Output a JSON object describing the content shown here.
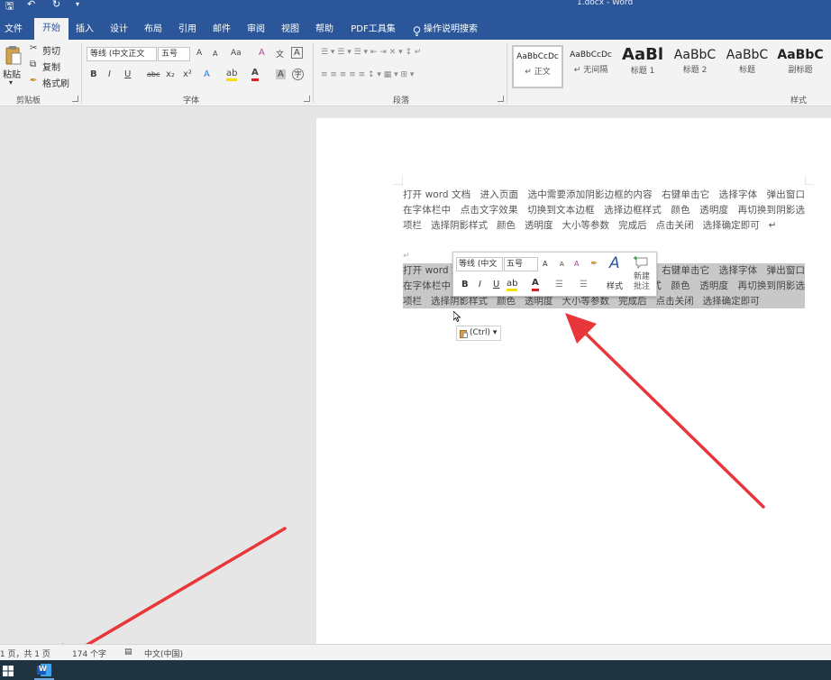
{
  "window": {
    "title": "1.docx - Word",
    "quick_access": {
      "save": "🖫",
      "undo": "↶",
      "redo": "↻",
      "customize": "▾"
    }
  },
  "tabs": [
    {
      "label": "文件"
    },
    {
      "label": "开始"
    },
    {
      "label": "插入"
    },
    {
      "label": "设计"
    },
    {
      "label": "布局"
    },
    {
      "label": "引用"
    },
    {
      "label": "邮件"
    },
    {
      "label": "审阅"
    },
    {
      "label": "视图"
    },
    {
      "label": "帮助"
    },
    {
      "label": "PDF工具集"
    }
  ],
  "tell_me": "操作说明搜索",
  "ribbon": {
    "clipboard": {
      "paste": "粘贴",
      "cut": "剪切",
      "copy": "复制",
      "format_painter": "格式刷",
      "group": "剪贴板"
    },
    "font": {
      "font_name": "等线 (中文正文",
      "font_size": "五号",
      "grow": "A",
      "shrink": "A",
      "change_case": "Aa",
      "clear_format": "A",
      "phonetic": "文",
      "char_border": "A",
      "bold": "B",
      "italic": "I",
      "underline": "U",
      "strike": "abc",
      "subscript": "x₂",
      "superscript": "x²",
      "text_effect": "A",
      "highlight": "ab",
      "font_color": "A",
      "char_shading": "A",
      "enclose": "字",
      "group": "字体"
    },
    "paragraph": {
      "group": "段落",
      "row1": "☰ ▾  ☰ ▾  ☰ ▾   ⇤  ⇥   ✕ ▾   ↕  ↵",
      "row2": "≡  ≡  ≡  ≡  ≡   ↕ ▾   ▦ ▾  ⊞ ▾"
    },
    "styles": {
      "group": "样式",
      "items": [
        {
          "preview": "AaBbCcDc",
          "name": "↵ 正文"
        },
        {
          "preview": "AaBbCcDc",
          "name": "↵ 无间隔"
        },
        {
          "preview": "AaBl",
          "name": "标题 1"
        },
        {
          "preview": "AaBbC",
          "name": "标题 2"
        },
        {
          "preview": "AaBbC",
          "name": "标题"
        },
        {
          "preview": "AaBbC",
          "name": "副标题"
        }
      ]
    }
  },
  "document": {
    "paragraph1": "打开 word 文档   进入页面   选中需要添加阴影边框的内容   右键单击它   选择字体   弹出窗口   在字体栏中   点击文字效果   切换到文本边框   选择边框样式   颜色   透明度   再切换到阴影选项栏   选择阴影样式   颜色   透明度   大小等参数   完成后   点击关闭   选择确定即可   ↵",
    "empty_mark": "↵",
    "paragraph2": "打开 word 文档   进入页面   选中需要添加阴影边框的内容   右键单击它   选择字体   弹出窗口   在字体栏中   点击文字效果   切换到文本边框   选择边框样式   颜色   透明度   再切换到阴影选项栏   选择阴影样式   颜色   透明度   大小等参数   完成后   点击关闭   选择确定即可"
  },
  "mini_toolbar": {
    "font_name": "等线 (中文",
    "font_size": "五号",
    "grow": "A",
    "shrink": "A",
    "clear": "A",
    "painter": "✒",
    "styles_icon": "A",
    "bold": "B",
    "italic": "I",
    "underline": "U",
    "highlight": "ab",
    "font_color": "A",
    "bullets": "☰",
    "numbering": "☰",
    "styles_label": "样式",
    "new_comment": "新建\n批注"
  },
  "paste_options": "(Ctrl) ▾",
  "status": {
    "page": "第 1 页，共 1 页",
    "words": "174 个字",
    "language": "中文(中国)"
  },
  "taskbar": {
    "word_letter": "W"
  },
  "colors": {
    "word_blue": "#2b579a",
    "annotation_red": "#e8363a"
  }
}
